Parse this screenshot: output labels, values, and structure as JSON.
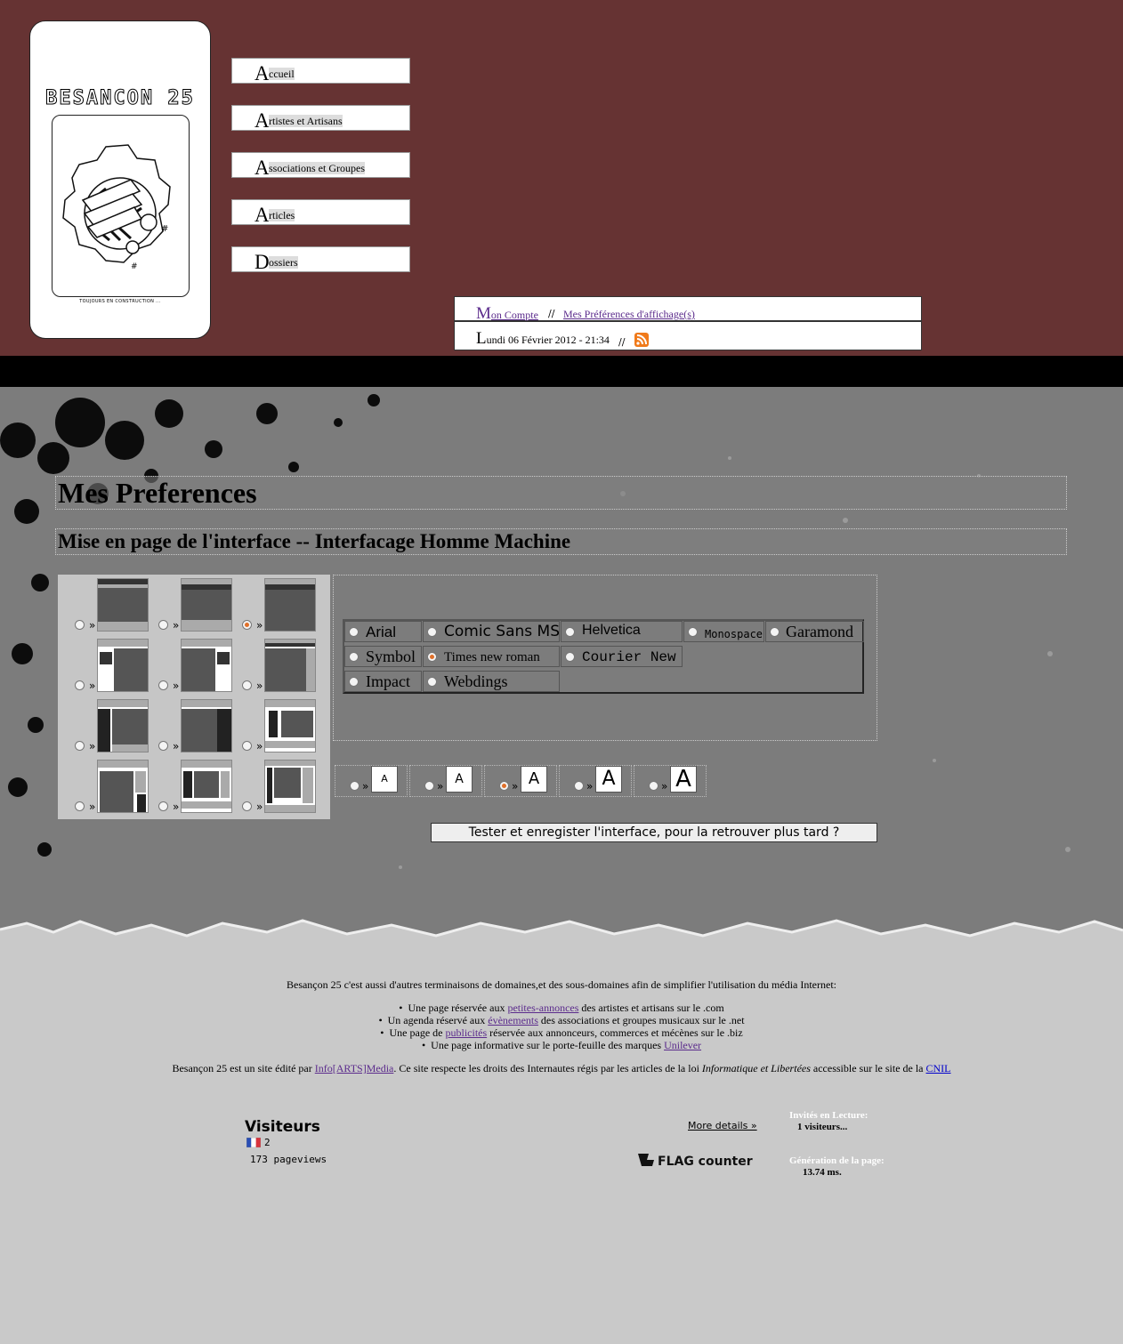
{
  "header": {
    "logo": {
      "title": "BESANCON 25",
      "caption": "TOUJOURS EN CONSTRUCTION ..."
    },
    "nav": [
      {
        "first": "A",
        "rest": "ccueil"
      },
      {
        "first": "A",
        "rest": "rtistes et Artisans"
      },
      {
        "first": "A",
        "rest": "ssociations et Groupes"
      },
      {
        "first": "A",
        "rest": "rticles"
      },
      {
        "first": "D",
        "rest": "ossiers"
      }
    ],
    "account": {
      "first": "M",
      "rest": "on Compte",
      "sep": "//",
      "prefs": "Mes Préférences d'affichage(s)"
    },
    "date": {
      "first": "L",
      "rest": "undi 06 Février 2012 - 21:34",
      "sep": "//",
      "rss_icon": "rss-icon"
    }
  },
  "main": {
    "title": "Mes Preferences",
    "subtitle": "Mise en page de l'interface -- Interfacage Homme Machine",
    "raquo": "»",
    "layout_selected_index": 2,
    "fonts": [
      {
        "label": "Arial",
        "selected": false
      },
      {
        "label": "Comic Sans MS",
        "selected": false
      },
      {
        "label": "Helvetica",
        "selected": false
      },
      {
        "label": "Monospace",
        "selected": false
      },
      {
        "label": "Garamond",
        "selected": false
      },
      {
        "label": "Symbol",
        "selected": false
      },
      {
        "label": "Times new roman",
        "selected": true
      },
      {
        "label": "Courier New",
        "selected": false
      },
      {
        "label": "Impact",
        "selected": false
      },
      {
        "label": "Webdings",
        "selected": false
      }
    ],
    "sizes": [
      {
        "glyph": "A",
        "selected": false
      },
      {
        "glyph": "A",
        "selected": false
      },
      {
        "glyph": "A",
        "selected": true
      },
      {
        "glyph": "A",
        "selected": false
      },
      {
        "glyph": "A",
        "selected": false
      }
    ],
    "save_label": "Tester et enregister l'interface, pour la retrouver plus tard ?"
  },
  "footer": {
    "intro": "Besançon 25 c'est aussi d'autres terminaisons de domaines,et des sous-domaines afin de simplifier l'utilisation du média Internet:",
    "items": [
      {
        "pre": "Une page réservée aux ",
        "link": "petites-annonces",
        "post": " des artistes et artisans sur le .com"
      },
      {
        "pre": "Un agenda réservé aux ",
        "link": "évènements",
        "post": " des associations et groupes musicaux sur le .net"
      },
      {
        "pre": "Une page de ",
        "link": "publicités",
        "post": " réservée aux annonceurs, commerces et mécènes sur le .biz"
      },
      {
        "pre": "Une page informative sur le porte-feuille des marques ",
        "link": "Unilever",
        "post": ""
      }
    ],
    "credit": {
      "pre": "Besançon 25 est un site édité par ",
      "link": "Info[ARTS]Media",
      "mid": ". Ce site respecte les droits des Internautes régis par les articles de la loi ",
      "em": "Informatique et Libertées",
      "post": " accessible sur le site de la ",
      "cnil": "CNIL"
    },
    "visitors": {
      "title": "Visiteurs",
      "count": "2",
      "pageviews": "173 pageviews",
      "more": "More details »",
      "flag_logo": "FLAG counter"
    },
    "stats": {
      "readers_label": "Invités en Lecture:",
      "readers_value": "1 visiteurs...",
      "gen_label": "Génération de la page:",
      "gen_value": "13.74 ms."
    }
  }
}
